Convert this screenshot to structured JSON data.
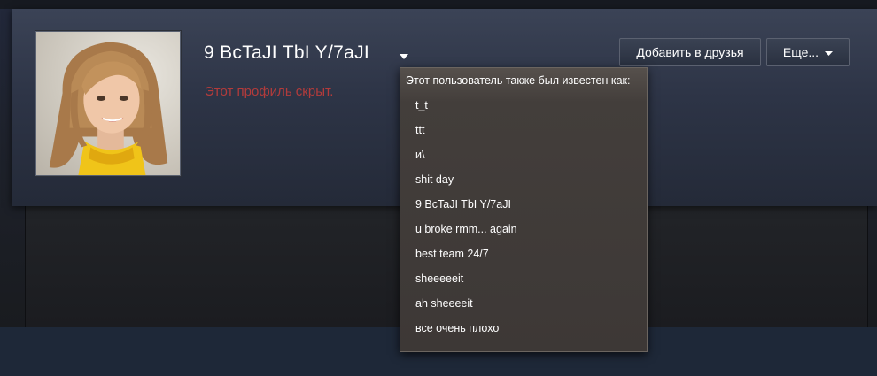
{
  "profile": {
    "persona_name": "9 BcTaJI TbI Y/7aJI",
    "private_text": "Этот профиль скрыт."
  },
  "buttons": {
    "add_friend": "Добавить в друзья",
    "more": "Еще..."
  },
  "icons": {
    "name_dropdown": "caret-down-icon",
    "more_dropdown": "caret-down-icon"
  },
  "alias_menu": {
    "header": "Этот пользователь также был известен как:",
    "aliases": [
      "t_t",
      "ttt",
      "и\\",
      "shit day",
      "9 BcTaJI TbI Y/7aJI",
      "u broke rmm... again",
      "best team 24/7",
      "sheeeeeit",
      "ah sheeeeit",
      "все очень плохо"
    ]
  },
  "colors": {
    "page_background": "#1b2838",
    "private_text": "#b33b3b",
    "menu_background": "#3d3836"
  }
}
